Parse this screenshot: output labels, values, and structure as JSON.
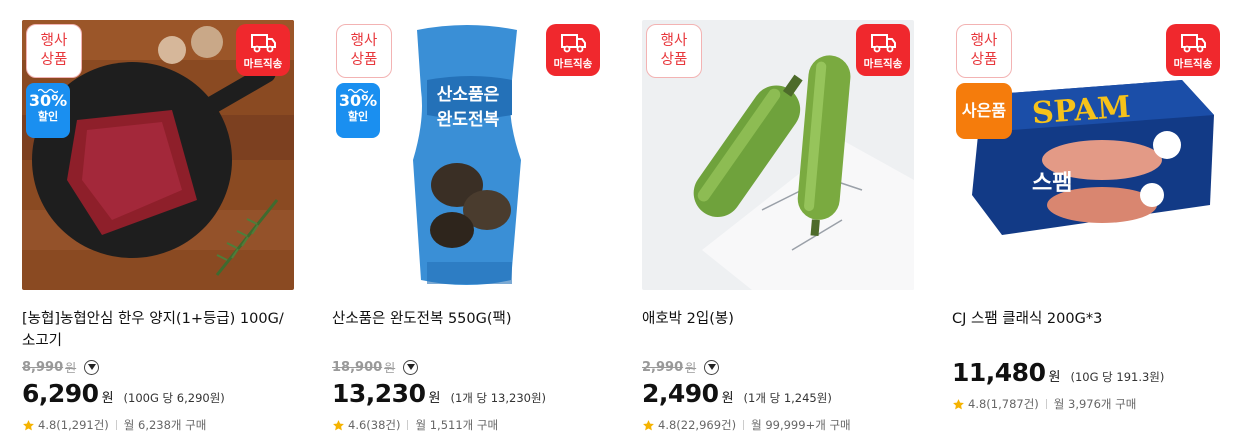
{
  "colors": {
    "accent_red": "#f0282d",
    "discount_blue": "#1a8ff0",
    "gift_orange": "#f57c0c",
    "star": "#f5b301"
  },
  "badges": {
    "event_line1": "행사",
    "event_line2": "상품",
    "mart": "마트직송",
    "gift": "사은품"
  },
  "products": [
    {
      "name": "[농협]농협안심 한우 양지(1+등급) 100G/소고기",
      "discount_pct": "30%",
      "discount_label": "할인",
      "original_price": "8,990",
      "original_unit": "원",
      "price": "6,290",
      "price_unit": "원",
      "unit_price": "(100G 당 6,290원)",
      "rating": "4.8(1,291건)",
      "monthly": "월 6,238개 구매",
      "image_icon": "beef-on-pan"
    },
    {
      "name": "산소품은 완도전복 550G(팩)",
      "discount_pct": "30%",
      "discount_label": "할인",
      "original_price": "18,900",
      "original_unit": "원",
      "price": "13,230",
      "price_unit": "원",
      "unit_price": "(1개 당 13,230원)",
      "rating": "4.6(38건)",
      "monthly": "월 1,511개 구매",
      "image_icon": "abalone-pack",
      "package_text": "산소품은 완도전복"
    },
    {
      "name": "애호박 2입(봉)",
      "original_price": "2,990",
      "original_unit": "원",
      "price": "2,490",
      "price_unit": "원",
      "unit_price": "(1개 당 1,245원)",
      "rating": "4.8(22,969건)",
      "monthly": "월 99,999+개 구매",
      "image_icon": "zucchini"
    },
    {
      "name": "CJ 스팸 클래식 200G*3",
      "price": "11,480",
      "price_unit": "원",
      "unit_price": "(10G 당 191.3원)",
      "rating": "4.8(1,787건)",
      "monthly": "월 3,976개 구매",
      "image_icon": "spam-cans",
      "package_text": "SPAM"
    }
  ]
}
